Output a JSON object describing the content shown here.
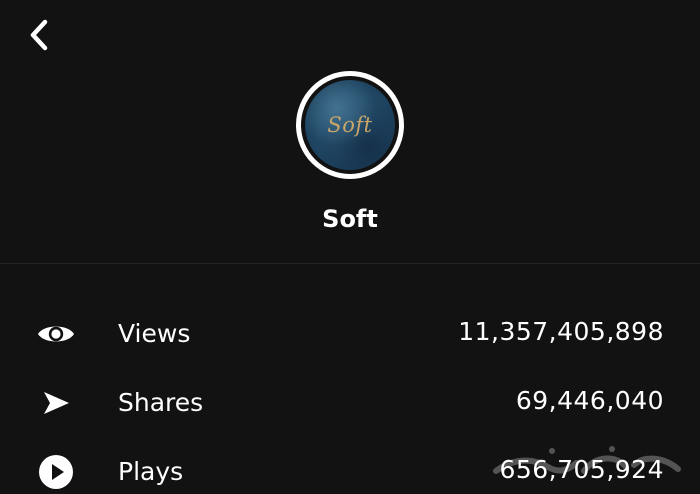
{
  "header": {
    "back_icon": "chevron-left-icon"
  },
  "profile": {
    "avatar_text": "Soft",
    "avatar_colors": {
      "ring": "#ffffff",
      "background": "#1f4663",
      "text": "#c9a56a"
    },
    "name": "Soft"
  },
  "stats": [
    {
      "icon": "eye-icon",
      "label": "Views",
      "value": "11,357,405,898"
    },
    {
      "icon": "share-arrow-icon",
      "label": "Shares",
      "value": "69,446,040"
    },
    {
      "icon": "play-circle-icon",
      "label": "Plays",
      "value": "656,705,924"
    }
  ],
  "colors": {
    "background": "#121212",
    "text": "#ffffff",
    "divider": "#242424"
  }
}
